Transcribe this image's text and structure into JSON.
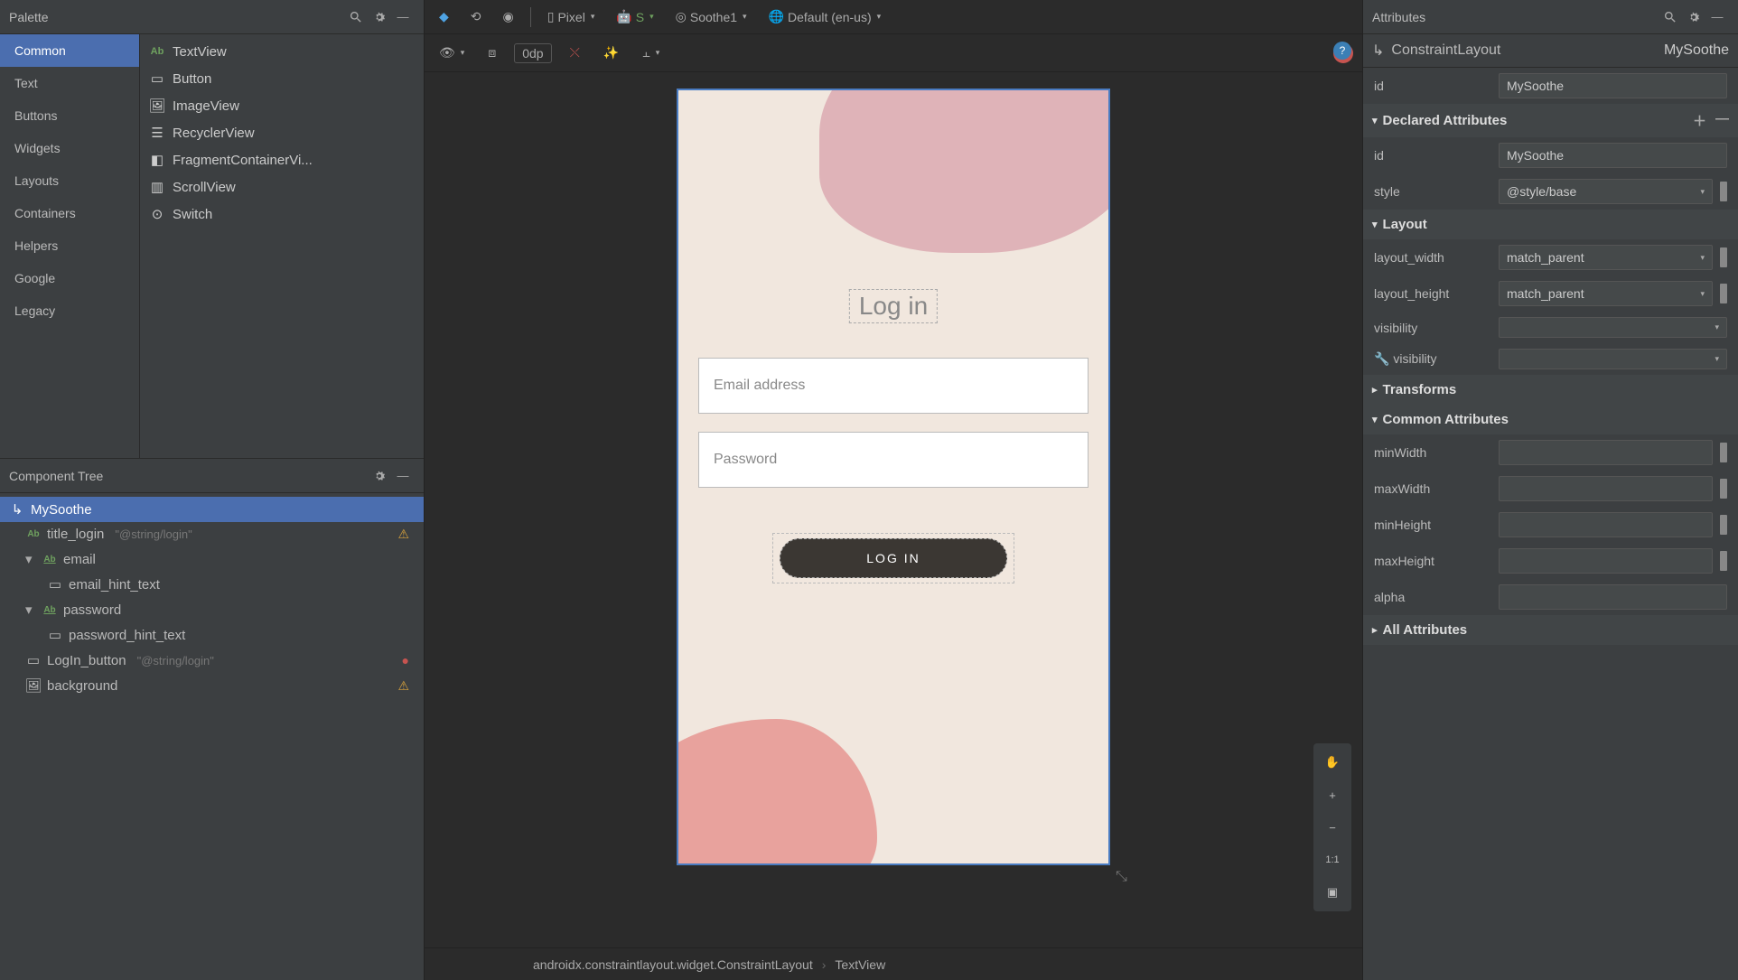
{
  "palette": {
    "title": "Palette",
    "categories": [
      "Common",
      "Text",
      "Buttons",
      "Widgets",
      "Layouts",
      "Containers",
      "Helpers",
      "Google",
      "Legacy"
    ],
    "selected_category": 0,
    "items": [
      {
        "icon": "Ab",
        "label": "TextView"
      },
      {
        "icon": "btn",
        "label": "Button"
      },
      {
        "icon": "img",
        "label": "ImageView"
      },
      {
        "icon": "list",
        "label": "RecyclerView"
      },
      {
        "icon": "frag",
        "label": "FragmentContainerVi..."
      },
      {
        "icon": "scroll",
        "label": "ScrollView"
      },
      {
        "icon": "switch",
        "label": "Switch"
      }
    ]
  },
  "component_tree": {
    "title": "Component Tree",
    "nodes": [
      {
        "depth": 0,
        "icon": "layout",
        "label": "MySoothe",
        "selected": true
      },
      {
        "depth": 1,
        "icon": "Ab",
        "label": "title_login",
        "extra": "\"@string/login\"",
        "status": "warn"
      },
      {
        "depth": 1,
        "icon": "Ab",
        "label": "email",
        "chev": "v"
      },
      {
        "depth": 2,
        "icon": "box",
        "label": "email_hint_text"
      },
      {
        "depth": 1,
        "icon": "Ab",
        "label": "password",
        "chev": "v"
      },
      {
        "depth": 2,
        "icon": "box",
        "label": "password_hint_text"
      },
      {
        "depth": 1,
        "icon": "box",
        "label": "LogIn_button",
        "extra": "\"@string/login\"",
        "status": "err"
      },
      {
        "depth": 1,
        "icon": "img",
        "label": "background",
        "status": "warn"
      }
    ]
  },
  "toolbar": {
    "device": "Pixel",
    "api": "S",
    "theme": "Soothe1",
    "locale": "Default (en-us)",
    "dp": "0dp"
  },
  "preview": {
    "title": "Log in",
    "email_hint": "Email address",
    "password_hint": "Password",
    "button": "LOG IN"
  },
  "breadcrumb": {
    "a": "androidx.constraintlayout.widget.ConstraintLayout",
    "b": "TextView"
  },
  "attributes": {
    "title": "Attributes",
    "class": "ConstraintLayout",
    "name": "MySoothe",
    "id_label": "id",
    "id_value": "MySoothe",
    "declared": {
      "title": "Declared Attributes",
      "rows": [
        {
          "k": "id",
          "v": "MySoothe"
        },
        {
          "k": "style",
          "v": "@style/base",
          "dropdown": true
        }
      ]
    },
    "layout": {
      "title": "Layout",
      "rows": [
        {
          "k": "layout_width",
          "v": "match_parent",
          "dropdown": true
        },
        {
          "k": "layout_height",
          "v": "match_parent",
          "dropdown": true
        },
        {
          "k": "visibility",
          "v": "",
          "dropdown": true
        },
        {
          "k": "visibility",
          "v": "",
          "dropdown": true,
          "tools": true
        }
      ]
    },
    "transforms": {
      "title": "Transforms"
    },
    "common": {
      "title": "Common Attributes",
      "rows": [
        {
          "k": "minWidth",
          "v": ""
        },
        {
          "k": "maxWidth",
          "v": ""
        },
        {
          "k": "minHeight",
          "v": ""
        },
        {
          "k": "maxHeight",
          "v": ""
        },
        {
          "k": "alpha",
          "v": ""
        }
      ]
    },
    "all": {
      "title": "All Attributes"
    }
  },
  "floating": {
    "pan": "✋",
    "zoom_in": "+",
    "zoom_out": "−",
    "one_to_one": "1:1",
    "fit": "▣"
  }
}
